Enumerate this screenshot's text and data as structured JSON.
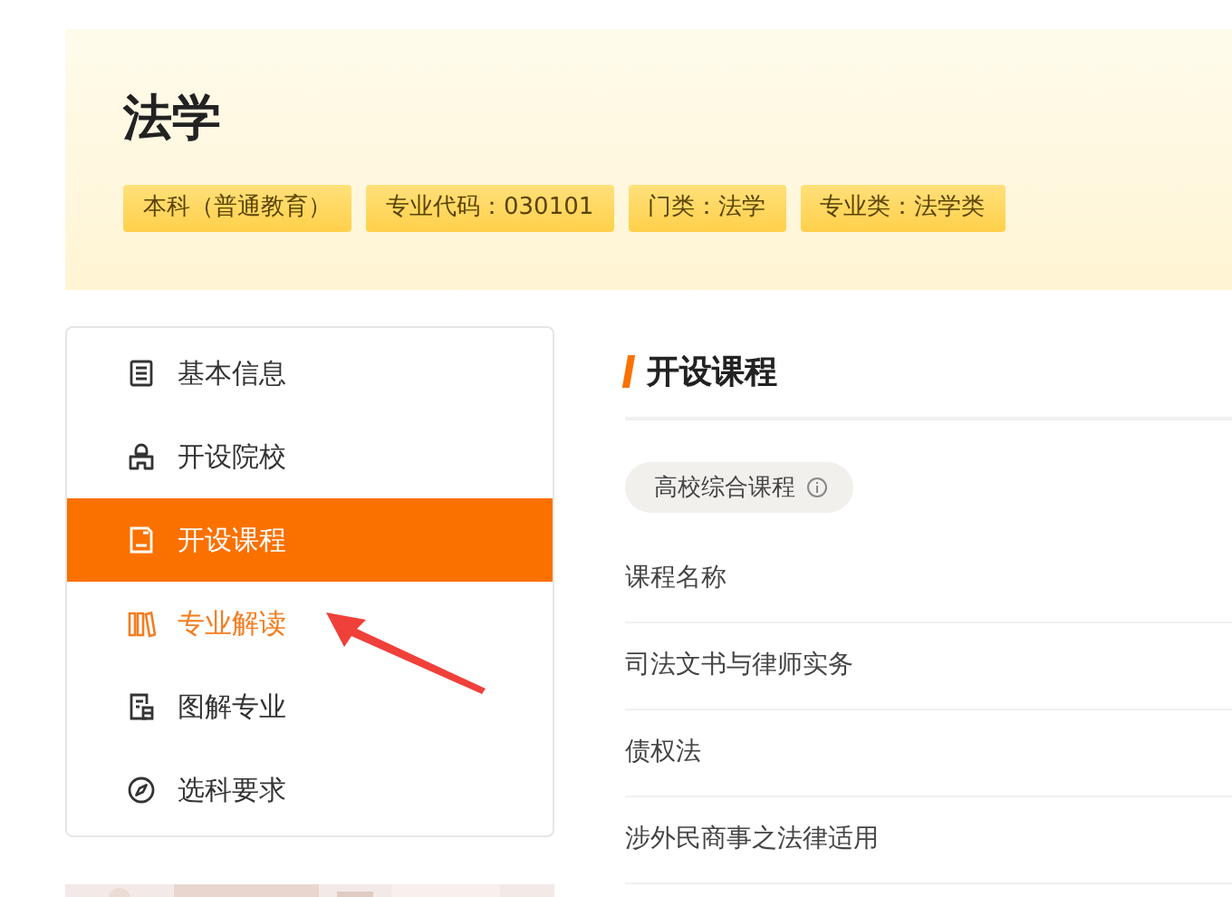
{
  "header": {
    "title": "法学",
    "tags": [
      "本科（普通教育）",
      "专业代码：030101",
      "门类：法学",
      "专业类：法学类"
    ]
  },
  "sidebar": {
    "items": [
      {
        "label": "基本信息",
        "selected": false,
        "hovered": false
      },
      {
        "label": "开设院校",
        "selected": false,
        "hovered": false
      },
      {
        "label": "开设课程",
        "selected": true,
        "hovered": false
      },
      {
        "label": "专业解读",
        "selected": false,
        "hovered": true
      },
      {
        "label": "图解专业",
        "selected": false,
        "hovered": false
      },
      {
        "label": "选科要求",
        "selected": false,
        "hovered": false
      }
    ]
  },
  "section": {
    "title": "开设课程",
    "filter": "高校综合课程",
    "table": {
      "header": "课程名称",
      "rows": [
        "司法文书与律师实务",
        "债权法",
        "涉外民商事之法律适用"
      ]
    }
  },
  "annotation": {
    "kind": "arrow"
  }
}
